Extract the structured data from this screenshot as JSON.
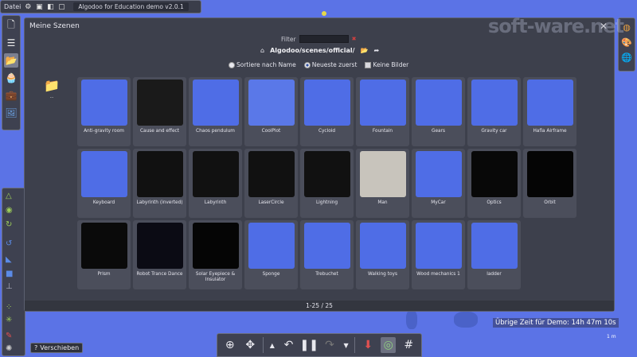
{
  "app": {
    "menu_label": "Datei",
    "title": "Algodoo for Education demo v2.0.1",
    "watermark": "soft-ware.net"
  },
  "dialog": {
    "title": "Meine Szenen",
    "close": "✕",
    "filter_label": "Filter",
    "filter_value": "",
    "filter_clear": "✖",
    "path": "Algodoo/scenes/official/",
    "sort_by_name": "Sortiere nach Name",
    "newest_first": "Neueste zuerst",
    "no_images": "Keine Bilder",
    "up_folder_label": "..",
    "pager": "1-25 / 25"
  },
  "scenes": [
    {
      "name": "Anti-gravity room",
      "bg": "#4f6de6"
    },
    {
      "name": "Cause and effect",
      "bg": "#1a1a1a"
    },
    {
      "name": "Chaos pendulum",
      "bg": "#4f6de6"
    },
    {
      "name": "CoolPlot",
      "bg": "#5a78e8"
    },
    {
      "name": "Cycloid",
      "bg": "#4f6de6"
    },
    {
      "name": "Fountain",
      "bg": "#4f6de6"
    },
    {
      "name": "Gears",
      "bg": "#4f6de6"
    },
    {
      "name": "Gravity car",
      "bg": "#4f6de6"
    },
    {
      "name": "Hafla Airframe",
      "bg": "#4f6de6"
    },
    {
      "name": "Keyboard",
      "bg": "#4f6de6"
    },
    {
      "name": "Labyrinth (inverted)",
      "bg": "#111111"
    },
    {
      "name": "Labyrinth",
      "bg": "#111111"
    },
    {
      "name": "LaserCircle",
      "bg": "#111111"
    },
    {
      "name": "Lightning",
      "bg": "#111111"
    },
    {
      "name": "Man",
      "bg": "#c8c4bc"
    },
    {
      "name": "MyCar",
      "bg": "#4f6de6"
    },
    {
      "name": "Optics",
      "bg": "#080808"
    },
    {
      "name": "Orbit",
      "bg": "#050505"
    },
    {
      "name": "Prism",
      "bg": "#0a0a0a"
    },
    {
      "name": "Robot Trance Dance",
      "bg": "#0b0b14"
    },
    {
      "name": "Solar Eyepiece & Insulator",
      "bg": "#050505"
    },
    {
      "name": "Sponge",
      "bg": "#4f6de6"
    },
    {
      "name": "Trebuchet",
      "bg": "#4f6de6"
    },
    {
      "name": "Walking toys",
      "bg": "#4f6de6"
    },
    {
      "name": "Wood mechanics 1",
      "bg": "#4f6de6"
    },
    {
      "name": "ladder",
      "bg": "#4f6de6"
    }
  ],
  "bottombar": {
    "timer": "Übrige Zeit für Demo: 14h 47m 10s"
  },
  "shift_label": "Verschieben",
  "scale_label": "1 m"
}
